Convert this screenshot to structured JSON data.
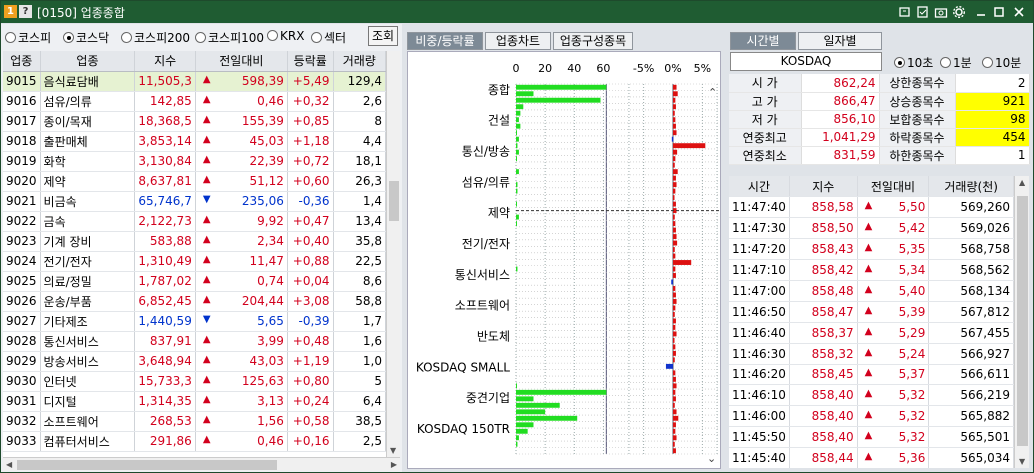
{
  "window": {
    "badge1": "1",
    "badge2": "?",
    "title": "[0150] 업종종합"
  },
  "left": {
    "markets": [
      {
        "label": "코스피",
        "selected": false
      },
      {
        "label": "코스닥",
        "selected": true
      },
      {
        "label": "코스피200",
        "selected": false
      },
      {
        "label": "코스피100",
        "selected": false
      },
      {
        "label": "KRX",
        "selected": false
      },
      {
        "label": "섹터",
        "selected": false
      }
    ],
    "lookup_label": "조회",
    "headers": [
      "업종",
      "업종",
      "지수",
      "전일대비",
      "등락률",
      "거래량"
    ],
    "rows": [
      {
        "code": "9015",
        "name": "음식료담배",
        "index": "11,505,3",
        "dir": "up",
        "change": "598,39",
        "rate": "+5,49",
        "volume": "129,4"
      },
      {
        "code": "9016",
        "name": "섬유/의류",
        "index": "142,85",
        "dir": "up",
        "change": "0,46",
        "rate": "+0,32",
        "volume": "2,6"
      },
      {
        "code": "9017",
        "name": "종이/목재",
        "index": "18,368,5",
        "dir": "up",
        "change": "155,39",
        "rate": "+0,85",
        "volume": "8"
      },
      {
        "code": "9018",
        "name": "출판매체",
        "index": "3,853,14",
        "dir": "up",
        "change": "45,03",
        "rate": "+1,18",
        "volume": "4,4"
      },
      {
        "code": "9019",
        "name": "화학",
        "index": "3,130,84",
        "dir": "up",
        "change": "22,39",
        "rate": "+0,72",
        "volume": "18,1"
      },
      {
        "code": "9020",
        "name": "제약",
        "index": "8,637,81",
        "dir": "up",
        "change": "51,12",
        "rate": "+0,60",
        "volume": "26,3"
      },
      {
        "code": "9021",
        "name": "비금속",
        "index": "65,746,7",
        "dir": "down",
        "change": "235,06",
        "rate": "-0,36",
        "volume": "1,4"
      },
      {
        "code": "9022",
        "name": "금속",
        "index": "2,122,73",
        "dir": "up",
        "change": "9,92",
        "rate": "+0,47",
        "volume": "13,4"
      },
      {
        "code": "9023",
        "name": "기계 장비",
        "index": "583,88",
        "dir": "up",
        "change": "2,34",
        "rate": "+0,40",
        "volume": "35,8"
      },
      {
        "code": "9024",
        "name": "전기/전자",
        "index": "1,310,49",
        "dir": "up",
        "change": "11,47",
        "rate": "+0,88",
        "volume": "22,5"
      },
      {
        "code": "9025",
        "name": "의료/정밀",
        "index": "1,787,02",
        "dir": "up",
        "change": "0,74",
        "rate": "+0,04",
        "volume": "8,6"
      },
      {
        "code": "9026",
        "name": "운송/부품",
        "index": "6,852,45",
        "dir": "up",
        "change": "204,44",
        "rate": "+3,08",
        "volume": "58,8"
      },
      {
        "code": "9027",
        "name": "기타제조",
        "index": "1,440,59",
        "dir": "down",
        "change": "5,65",
        "rate": "-0,39",
        "volume": "1,7"
      },
      {
        "code": "9028",
        "name": "통신서비스",
        "index": "837,91",
        "dir": "up",
        "change": "3,99",
        "rate": "+0,48",
        "volume": "1,6"
      },
      {
        "code": "9029",
        "name": "방송서비스",
        "index": "3,648,94",
        "dir": "up",
        "change": "43,03",
        "rate": "+1,19",
        "volume": "1,0"
      },
      {
        "code": "9030",
        "name": "인터넷",
        "index": "15,733,3",
        "dir": "up",
        "change": "125,63",
        "rate": "+0,80",
        "volume": "5"
      },
      {
        "code": "9031",
        "name": "디지털",
        "index": "1,314,35",
        "dir": "up",
        "change": "3,13",
        "rate": "+0,24",
        "volume": "6,4"
      },
      {
        "code": "9032",
        "name": "소프트웨어",
        "index": "268,53",
        "dir": "up",
        "change": "1,56",
        "rate": "+0,58",
        "volume": "38,5"
      },
      {
        "code": "9033",
        "name": "컴퓨터서비스",
        "index": "291,86",
        "dir": "up",
        "change": "0,46",
        "rate": "+0,16",
        "volume": "2,5"
      }
    ]
  },
  "middle": {
    "tabs": [
      {
        "label": "비중/등락률",
        "active": true
      },
      {
        "label": "업종차트",
        "active": false
      },
      {
        "label": "업종구성종목",
        "active": false
      }
    ]
  },
  "chart_data": {
    "type": "bar",
    "title": "",
    "left_axis_ticks": [
      "0",
      "20",
      "40",
      "60"
    ],
    "right_axis_ticks": [
      "-5%",
      "0%",
      "5%"
    ],
    "category_labels": [
      "종합",
      "건설",
      "통신/방송",
      "섬유/의류",
      "제약",
      "전기/전자",
      "통신서비스",
      "소프트웨어",
      "반도체",
      "KOSDAQ SMALL",
      "중견기업",
      "KOSDAQ 150TR"
    ],
    "series": [
      {
        "name": "비중",
        "color": "#22dd22",
        "values": [
          62,
          12,
          58,
          5,
          3,
          2,
          3,
          0.5,
          2,
          1,
          2,
          0.5,
          0,
          2,
          0,
          1,
          1,
          0,
          0.5,
          0,
          2,
          0.5,
          0,
          0,
          0,
          0,
          0,
          0,
          1,
          0,
          0,
          0,
          0,
          0,
          0,
          0,
          0,
          0,
          0,
          0,
          0,
          0,
          0,
          0,
          0,
          0,
          0.5,
          62,
          12,
          30,
          20,
          42,
          12,
          8,
          2,
          1,
          0
        ]
      },
      {
        "name": "등락률",
        "color": "#dd1111",
        "values": [
          0.6,
          0.8,
          0.4,
          0.5,
          0.3,
          0.4,
          0.5,
          0.6,
          -0.2,
          5.5,
          0.7,
          0.4,
          0.3,
          0.8,
          0.5,
          0.6,
          0.4,
          0.2,
          0.5,
          0.6,
          0.3,
          0.4,
          0.5,
          0.6,
          0.7,
          0.3,
          0.4,
          3.1,
          0.4,
          0.5,
          -0.3,
          0.4,
          0.5,
          0.6,
          0.4,
          0.3,
          0.5,
          0.4,
          0.6,
          0.2,
          0.4,
          0.5,
          0.3,
          -1.2,
          0.4,
          0.5,
          0.6,
          0.4,
          0.5,
          0.3,
          0.6,
          0.9,
          0.5,
          0.4,
          0.6,
          0.3,
          0.5
        ]
      }
    ]
  },
  "right": {
    "tabs": [
      {
        "label": "시간별",
        "active": true
      },
      {
        "label": "일자별",
        "active": false
      }
    ],
    "index_name": "KOSDAQ",
    "intervals": [
      {
        "label": "10초",
        "selected": true
      },
      {
        "label": "1분",
        "selected": false
      },
      {
        "label": "10분",
        "selected": false
      }
    ],
    "info": [
      {
        "l1": "시    가",
        "v1": "862,24",
        "l2": "상한종목수",
        "v2": "2",
        "yel": false
      },
      {
        "l1": "고    가",
        "v1": "866,47",
        "l2": "상승종목수",
        "v2": "921",
        "yel": true
      },
      {
        "l1": "저    가",
        "v1": "856,10",
        "l2": "보합종목수",
        "v2": "98",
        "yel": true
      },
      {
        "l1": "연중최고",
        "v1": "1,041,29",
        "l2": "하락종목수",
        "v2": "454",
        "yel": true
      },
      {
        "l1": "연중최소",
        "v1": "831,59",
        "l2": "하한종목수",
        "v2": "1",
        "yel": false
      }
    ],
    "headers": [
      "시간",
      "지수",
      "전일대비",
      "거래량(천)"
    ],
    "rows": [
      {
        "time": "11:47:40",
        "index": "858,58",
        "change": "5,50",
        "volume": "569,260"
      },
      {
        "time": "11:47:30",
        "index": "858,50",
        "change": "5,42",
        "volume": "569,026"
      },
      {
        "time": "11:47:20",
        "index": "858,43",
        "change": "5,35",
        "volume": "568,758"
      },
      {
        "time": "11:47:10",
        "index": "858,42",
        "change": "5,34",
        "volume": "568,562"
      },
      {
        "time": "11:47:00",
        "index": "858,48",
        "change": "5,40",
        "volume": "568,134"
      },
      {
        "time": "11:46:50",
        "index": "858,47",
        "change": "5,39",
        "volume": "567,812"
      },
      {
        "time": "11:46:40",
        "index": "858,37",
        "change": "5,29",
        "volume": "567,455"
      },
      {
        "time": "11:46:30",
        "index": "858,32",
        "change": "5,24",
        "volume": "566,927"
      },
      {
        "time": "11:46:20",
        "index": "858,45",
        "change": "5,37",
        "volume": "566,611"
      },
      {
        "time": "11:46:10",
        "index": "858,40",
        "change": "5,32",
        "volume": "566,219"
      },
      {
        "time": "11:46:00",
        "index": "858,40",
        "change": "5,32",
        "volume": "565,882"
      },
      {
        "time": "11:45:50",
        "index": "858,40",
        "change": "5,32",
        "volume": "565,501"
      },
      {
        "time": "11:45:40",
        "index": "858,44",
        "change": "5,36",
        "volume": "565,034"
      }
    ]
  }
}
